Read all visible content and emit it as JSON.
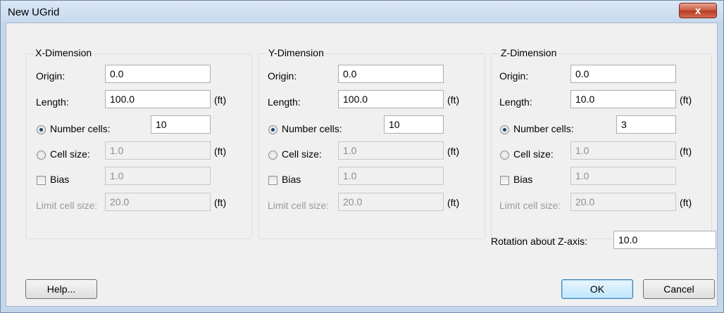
{
  "window": {
    "title": "New UGrid",
    "close_glyph": "x"
  },
  "labels": {
    "origin": "Origin:",
    "length": "Length:",
    "number_cells": "Number cells:",
    "cell_size": "Cell size:",
    "bias": "Bias",
    "limit_cell_size": "Limit cell size:",
    "unit": "(ft)"
  },
  "x_dimension": {
    "title": "X-Dimension",
    "origin": "0.0",
    "length": "100.0",
    "number_cells": "10",
    "cell_size": "1.0",
    "bias": "1.0",
    "limit_cell_size": "20.0"
  },
  "y_dimension": {
    "title": "Y-Dimension",
    "origin": "0.0",
    "length": "100.0",
    "number_cells": "10",
    "cell_size": "1.0",
    "bias": "1.0",
    "limit_cell_size": "20.0"
  },
  "z_dimension": {
    "title": "Z-Dimension",
    "origin": "0.0",
    "length": "10.0",
    "number_cells": "3",
    "cell_size": "1.0",
    "bias": "1.0",
    "limit_cell_size": "20.0"
  },
  "rotation": {
    "label": "Rotation about Z-axis:",
    "value": "10.0"
  },
  "buttons": {
    "help": "Help...",
    "ok": "OK",
    "cancel": "Cancel"
  }
}
